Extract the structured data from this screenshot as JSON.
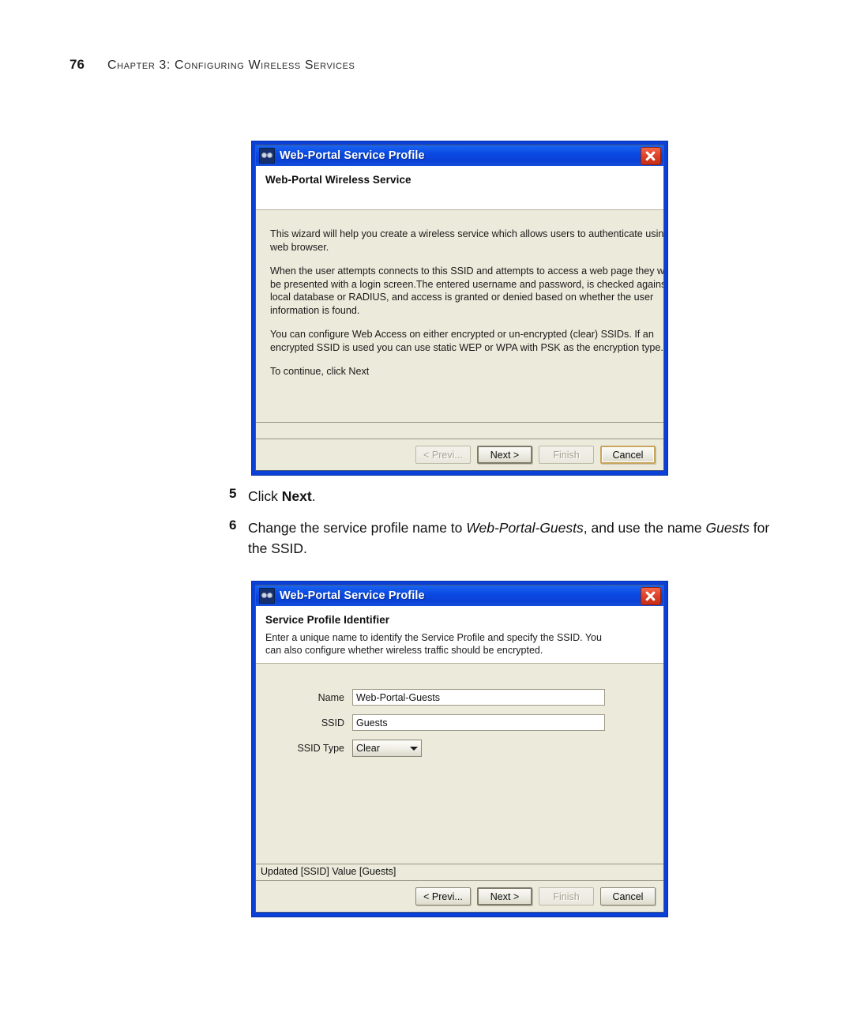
{
  "page": {
    "number": "76",
    "chapter_header": "Chapter 3: Configuring Wireless Services"
  },
  "dialog1": {
    "titlebar": {
      "title": "Web-Portal Service Profile",
      "icon": "binoculars-icon",
      "close_label": "Close"
    },
    "heading": "Web-Portal Wireless Service",
    "paragraphs": [
      [
        "This wizard will help you create a wireless service which allows users to authenticate using a",
        "web browser."
      ],
      [
        "When the user attempts connects to this SSID and attempts to access a web page they will",
        "be presented with a login screen.The entered username and password, is checked against the",
        "local database or RADIUS, and access is granted or denied based on whether the user",
        "information is found."
      ],
      [
        "You can configure Web Access on either encrypted or un-encrypted (clear) SSIDs. If an",
        "encrypted SSID is used you can use static WEP or WPA with PSK as the encryption type."
      ],
      [
        "To continue, click Next"
      ]
    ],
    "status": "",
    "buttons": {
      "previous": "< Previ...",
      "next": "Next >",
      "finish": "Finish",
      "cancel": "Cancel"
    }
  },
  "dialog2": {
    "titlebar": {
      "title": "Web-Portal Service Profile",
      "icon": "binoculars-icon",
      "close_label": "Close"
    },
    "heading": "Service Profile Identifier",
    "subtext": [
      "Enter a unique name to identify the Service Profile and specify the SSID. You",
      "can also configure whether wireless traffic should be encrypted."
    ],
    "form": {
      "name_label": "Name",
      "name_value": "Web-Portal-Guests",
      "ssid_label": "SSID",
      "ssid_value": "Guests",
      "ssid_type_label": "SSID Type",
      "ssid_type_value": "Clear"
    },
    "status": "Updated [SSID] Value [Guests]",
    "buttons": {
      "previous": "< Previ...",
      "next": "Next >",
      "finish": "Finish",
      "cancel": "Cancel"
    }
  },
  "steps": [
    {
      "number": "5",
      "parts": [
        {
          "text": "Click ",
          "style": "normal"
        },
        {
          "text": "Next",
          "style": "bold"
        },
        {
          "text": ".",
          "style": "normal"
        }
      ]
    },
    {
      "number": "6",
      "parts": [
        {
          "text": "Change the service profile name to ",
          "style": "normal"
        },
        {
          "text": "Web-Portal-Guests",
          "style": "italic"
        },
        {
          "text": ", and use the name ",
          "style": "normal"
        },
        {
          "text": "Guests",
          "style": "italic"
        },
        {
          "text": " for the SSID.",
          "style": "normal"
        }
      ]
    }
  ],
  "colors": {
    "titlebar_blue": "#0a4ae4",
    "dialog_frame_blue": "#0a3fd8",
    "content_beige": "#ECEADB",
    "close_red": "#e0452a"
  }
}
